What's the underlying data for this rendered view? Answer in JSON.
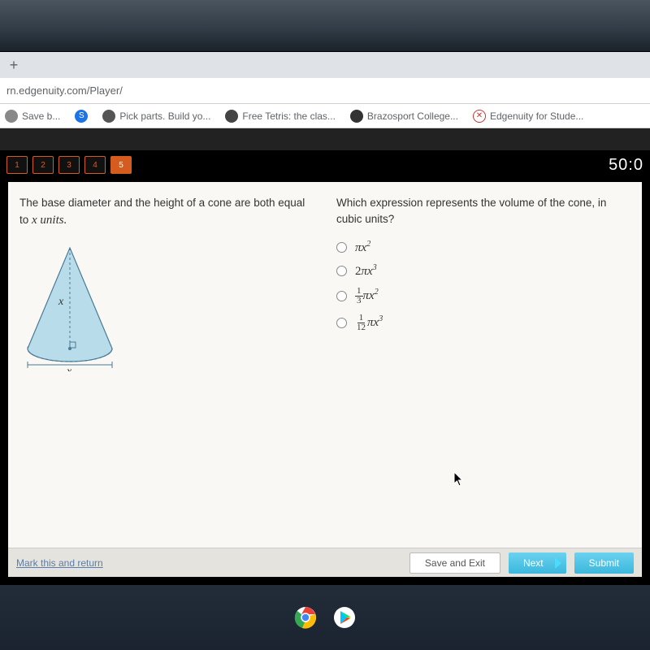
{
  "browser": {
    "url": "rn.edgenuity.com/Player/",
    "new_tab": "+"
  },
  "bookmarks": [
    {
      "label": "Save b...",
      "color": "#888"
    },
    {
      "label": "",
      "color": "#1a73e8",
      "letter": "S"
    },
    {
      "label": "Pick parts. Build yo...",
      "color": "#555"
    },
    {
      "label": "Free Tetris: the clas...",
      "color": "#444"
    },
    {
      "label": "Brazosport College...",
      "color": "#333"
    },
    {
      "label": "Edgenuity for Stude...",
      "color": "#c33",
      "letter": "✕"
    }
  ],
  "nav": {
    "items": [
      "1",
      "2",
      "3",
      "4",
      "5"
    ],
    "active_index": 4,
    "timer": "50:0"
  },
  "question": {
    "left_prompt_a": "The base diameter and the height of a cone are both equal to ",
    "left_prompt_b": "x units.",
    "right_prompt": "Which expression represents the volume of the cone, in cubic units?",
    "diagram": {
      "height_label": "x",
      "diameter_label": "x"
    }
  },
  "options": {
    "a": {
      "pi": "π",
      "var": "x",
      "sup": "2"
    },
    "b": {
      "coef": "2",
      "pi": "π",
      "var": "x",
      "sup": "3"
    },
    "c": {
      "frac_n": "1",
      "frac_d": "3",
      "pi": "π",
      "var": "x",
      "sup": "2"
    },
    "d": {
      "frac_n": "1",
      "frac_d": "12",
      "pi": "π",
      "var": "x",
      "sup": "3"
    }
  },
  "footer": {
    "mark": "Mark this and return",
    "save": "Save and Exit",
    "next": "Next",
    "submit": "Submit"
  }
}
